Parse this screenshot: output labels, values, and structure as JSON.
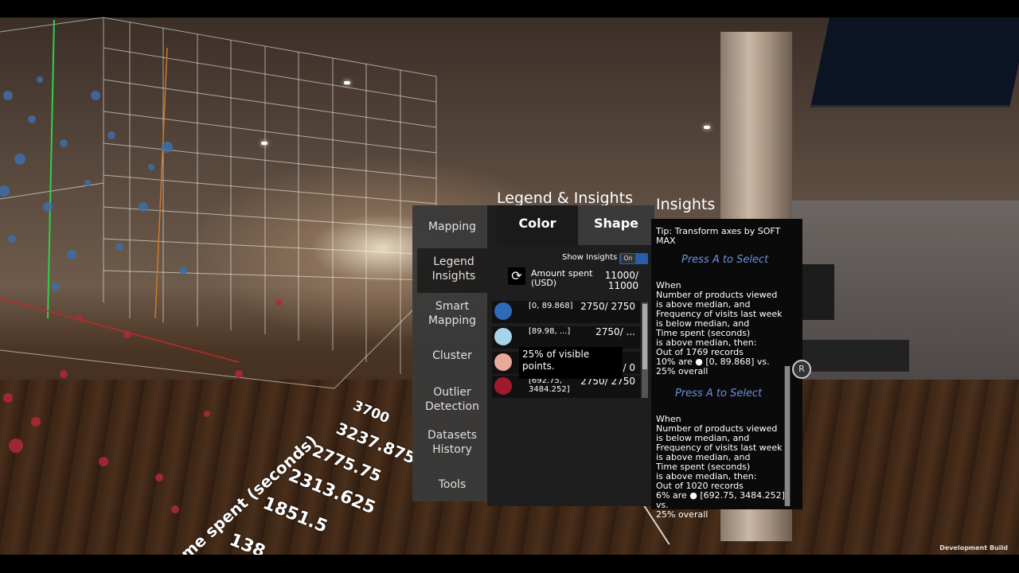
{
  "axis": {
    "title": "me spent (seconds)",
    "ticks": [
      "3700",
      "3237.875",
      "2775.75",
      "2313.625",
      "1851.5",
      "138"
    ]
  },
  "panel": {
    "legend_title": "Legend & Insights",
    "insights_title": "Insights",
    "menu": [
      "Mapping",
      "Legend Insights",
      "Smart Mapping",
      "Cluster",
      "Outlier Detection",
      "Datasets History",
      "Tools"
    ],
    "tabs": {
      "color": "Color",
      "shape": "Shape"
    },
    "show_insights_label": "Show Insights",
    "toggle_label": "On",
    "refresh_icon": "refresh-icon",
    "attribute": {
      "label": "Amount spent (USD)",
      "count": "11000/ 11000"
    },
    "legend": [
      {
        "color": "#2f6ab8",
        "range": "[0, 89.868]",
        "count": "2750/ 2750"
      },
      {
        "color": "#a8d4ea",
        "range": "[89.98, ...]",
        "count": "2750/ ..."
      },
      {
        "color": "#e8a89a",
        "range": "",
        "count": "/ 0"
      },
      {
        "color": "#a01a2e",
        "range": "[692.75, 3484.252]",
        "count": "2750/ 2750"
      }
    ],
    "tooltip": "25% of visible points."
  },
  "insights": {
    "tip": "Tip: Transform axes by SOFT MAX",
    "blocks": [
      {
        "press": "Press A to Select",
        "text": "When\nNumber of products viewed\n is above median, and\nFrequency of visits last week\n is below median, and\nTime spent (seconds)\n is above median, then:\nOut of 1769 records\n10% are ● [0, 89.868] vs.\n25% overall"
      },
      {
        "press": "Press A to Select",
        "text": "When\nNumber of products viewed\n is below median, and\nFrequency of visits last week\n is above median, and\nTime spent (seconds)\n is above median, then:\nOut of 1020 records\n6% are ● [692.75, 3484.252] vs.\n25% overall"
      }
    ],
    "r_button": "R"
  },
  "footer": {
    "build": "Development Build"
  }
}
